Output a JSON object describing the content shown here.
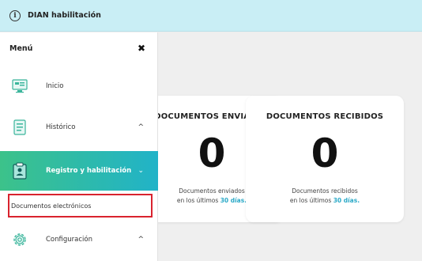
{
  "banner": {
    "text": "DIAN habilitación",
    "icon": "info-icon"
  },
  "sidebar": {
    "title": "Menú",
    "items": [
      {
        "label": "Inicio",
        "icon": "home-screen-icon"
      },
      {
        "label": "Histórico",
        "icon": "document-list-icon",
        "chevron": "^"
      },
      {
        "label": "Registro y habilitación",
        "icon": "clipboard-person-icon",
        "chevron": "⌄",
        "active": true
      },
      {
        "label": "Configuración",
        "icon": "gear-icon",
        "chevron": "^"
      }
    ],
    "subitem": {
      "label": "Documentos electrónicos"
    }
  },
  "cards": [
    {
      "title": "DOCUMENTOS ENVIADOS",
      "count": "0",
      "desc_line1": "Documentos enviados",
      "desc_line2_prefix": "en los últimos ",
      "desc_highlight": "30 días."
    },
    {
      "title": "DOCUMENTOS RECIBIDOS",
      "count": "0",
      "desc_line1": "Documentos recibidos",
      "desc_line2_prefix": "en los últimos ",
      "desc_highlight": "30 días."
    }
  ],
  "colors": {
    "banner": "#c9eef5",
    "active_start": "#3cc28a",
    "active_end": "#21b3c8",
    "highlight": "#2aa9c7",
    "selection_border": "#d9232e"
  }
}
